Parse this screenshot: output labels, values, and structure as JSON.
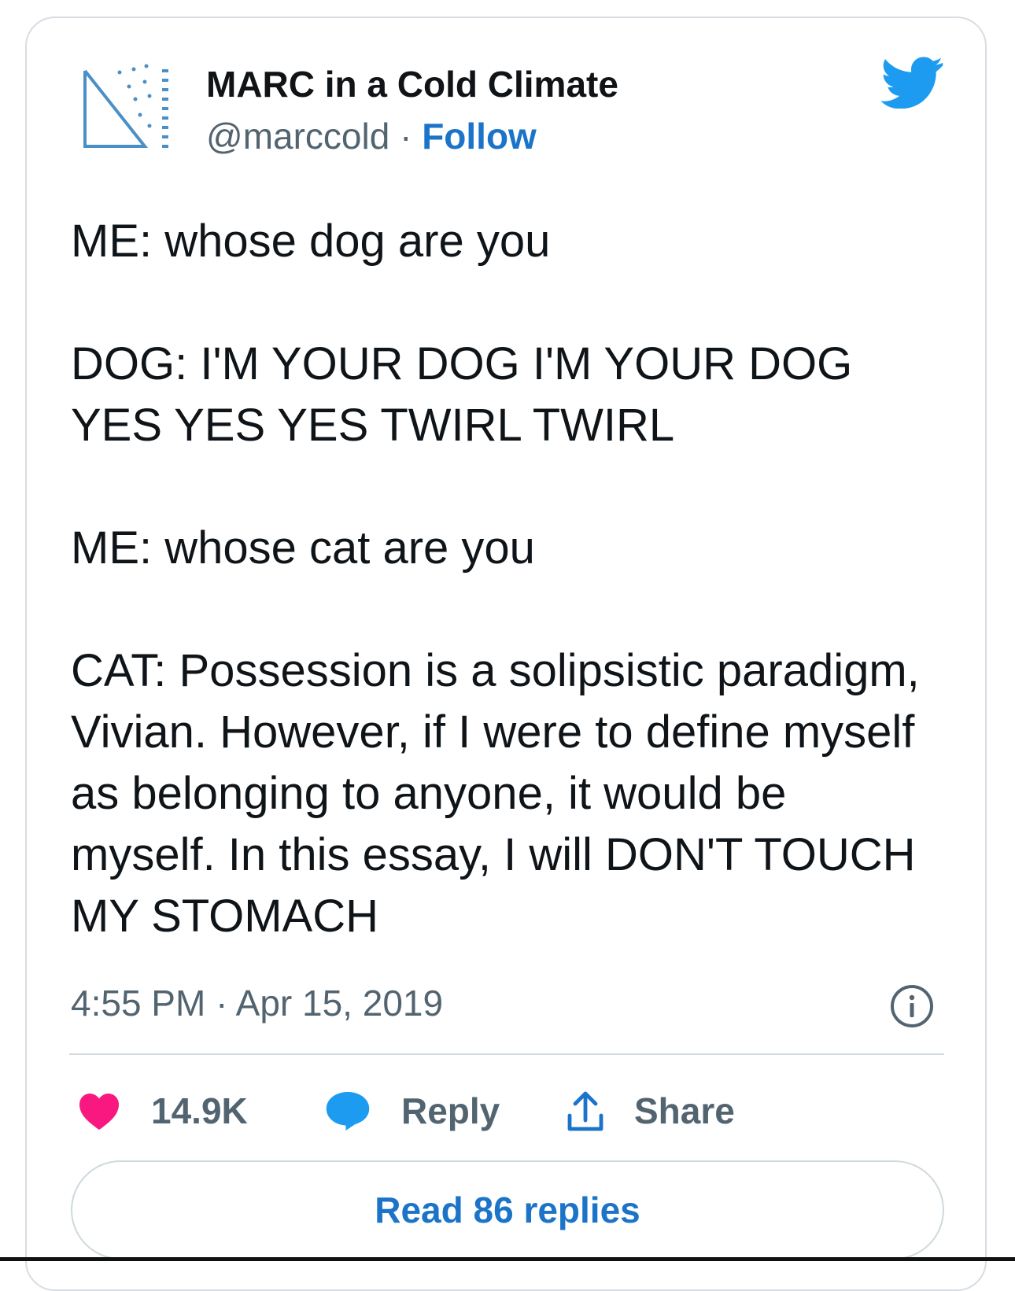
{
  "author": {
    "name": "MARC in a Cold Climate",
    "handle": "@marccold",
    "separator": "·",
    "follow_label": "Follow"
  },
  "icons": {
    "avatar": "triangle-ruler-logo",
    "brand": "twitter-bird-icon",
    "info": "info-icon",
    "like": "heart-icon",
    "reply": "speech-bubble-icon",
    "share": "share-upload-icon"
  },
  "tweet": {
    "line1": "ME: whose dog are you",
    "line2": "DOG: I'M YOUR DOG I'M YOUR DOG YES YES YES TWIRL TWIRL",
    "line3": "ME: whose cat are you",
    "line4": "CAT: Possession is a solipsistic paradigm, Vivian. However, if I were to define myself as belonging to anyone, it would be myself. In this essay, I will DON'T TOUCH MY STOMACH"
  },
  "timestamp": "4:55 PM · Apr 15, 2019",
  "actions": {
    "like_count": "14.9K",
    "reply_label": "Reply",
    "share_label": "Share"
  },
  "read_replies_label": "Read 86 replies",
  "colors": {
    "brand_blue": "#1d9bf0",
    "link_blue": "#1b74c8",
    "like_pink": "#f91880",
    "text_dark": "#0f1419",
    "text_gray": "#536471"
  }
}
